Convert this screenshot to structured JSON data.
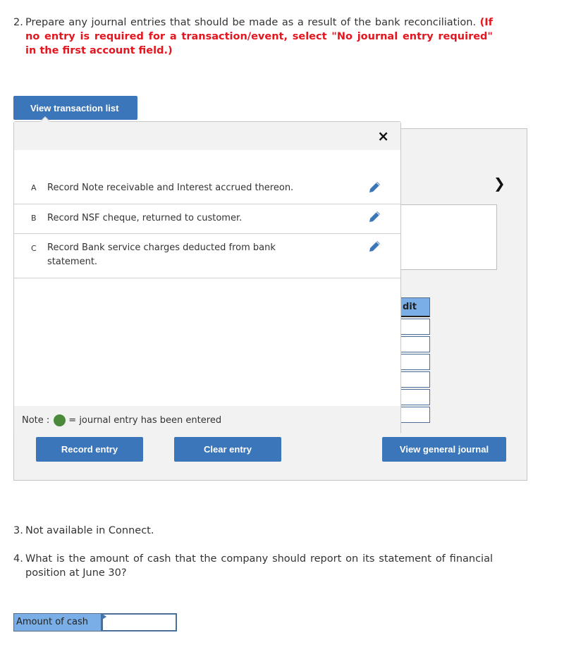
{
  "question2": {
    "number": "2.",
    "text": "Prepare any journal entries that should be made as a result of the bank reconciliation.",
    "instruction": "(If no entry is required for a transaction/event, select \"No journal entry required\" in the first account field.)"
  },
  "view_transaction_list_label": "View transaction list",
  "popup": {
    "close_icon": "×",
    "transactions": [
      {
        "letter": "A",
        "description": "Record Note receivable and Interest accrued thereon.",
        "icon": "pencil-icon"
      },
      {
        "letter": "B",
        "description": "Record NSF cheque, returned to customer.",
        "icon": "pencil-icon"
      },
      {
        "letter": "C",
        "description": "Record Bank service charges deducted from bank statement.",
        "icon": "pencil-icon"
      }
    ],
    "note_prefix": "Note :",
    "note_suffix": "= journal entry has been entered",
    "note_color": "#4b8a3b"
  },
  "journal_panel": {
    "next_icon": "›",
    "credit_header": "dit",
    "credit_rows": 6
  },
  "buttons": {
    "record_entry": "Record entry",
    "clear_entry": "Clear entry",
    "view_general_journal": "View general journal"
  },
  "question3": {
    "number": "3.",
    "text": "Not available in Connect."
  },
  "question4": {
    "number": "4.",
    "text": "What is the amount of cash that the company should report on its statement of financial position at June 30?"
  },
  "cash": {
    "label": "Amount of cash",
    "value": ""
  },
  "colors": {
    "button": "#3b76ba",
    "instruction_red": "#e4161f",
    "header_blue": "#7aaee6"
  }
}
